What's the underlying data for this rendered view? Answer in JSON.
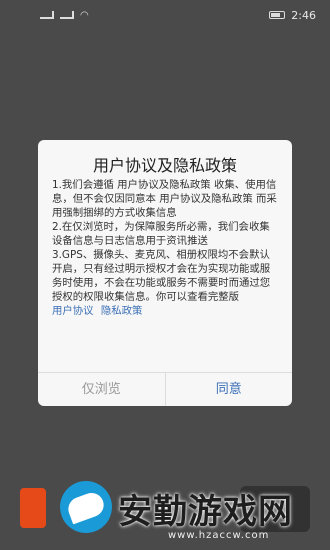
{
  "status_bar": {
    "time": "2:46",
    "left_icons": [
      "signal-icon",
      "signal-icon",
      "wifi-icon"
    ],
    "right_icons": [
      "battery-icon"
    ]
  },
  "dialog": {
    "title": "用户协议及隐私政策",
    "paragraphs": [
      "1.我们会遵循 用户协议及隐私政策 收集、使用信息，但不会仅因同意本 用户协议及隐私政策 而采用强制捆绑的方式收集信息",
      "2.在仅浏览时，为保障服务所必需，我们会收集设备信息与日志信息用于资讯推送",
      "3.GPS、摄像头、麦克风、相册权限均不会默认开启，只有经过明示授权才会在为实现功能或服务时使用，不会在功能或服务不需要时而通过您授权的权限收集信息。你可以查看完整版"
    ],
    "links": [
      "用户协议",
      "隐私政策"
    ],
    "browse_button": "仅浏览",
    "agree_button": "同意"
  },
  "watermark": {
    "brand": "安勤游戏网",
    "url": "www.hzaccw.com"
  },
  "colors": {
    "background": "#4a4a4a",
    "link": "#3b6fb6",
    "dialog_bg": "#f7f7f7"
  }
}
